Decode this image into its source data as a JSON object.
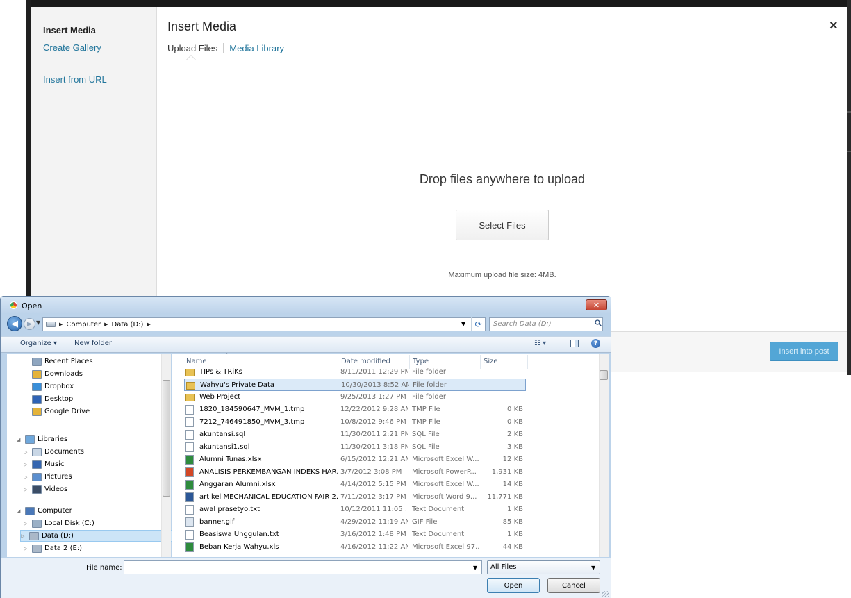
{
  "modal": {
    "sidebar_title": "Insert Media",
    "sidebar_links": [
      "Create Gallery",
      "Insert from URL"
    ],
    "title": "Insert Media",
    "close": "×",
    "tabs": [
      "Upload Files",
      "Media Library"
    ],
    "drop_text": "Drop files anywhere to upload",
    "select_button": "Select Files",
    "max_size": "Maximum upload file size: 4MB.",
    "insert_button": "Insert into post"
  },
  "dialog": {
    "title": "Open",
    "close": "✕",
    "breadcrumb": [
      "Computer",
      "Data (D:)"
    ],
    "search_placeholder": "Search Data (D:)",
    "organize": "Organize ▾",
    "new_folder": "New folder",
    "nav_items": [
      {
        "label": "Recent Places",
        "icon": "recent-places-icon",
        "color": "#8fa6c0"
      },
      {
        "label": "Downloads",
        "icon": "downloads-folder-icon",
        "color": "#e4b33a"
      },
      {
        "label": "Dropbox",
        "icon": "dropbox-icon",
        "color": "#3a8fd9"
      },
      {
        "label": "Desktop",
        "icon": "desktop-icon",
        "color": "#2f63b5"
      },
      {
        "label": "Google Drive",
        "icon": "google-drive-icon",
        "color": "#e4b33a"
      },
      {
        "label": "Libraries",
        "icon": "libraries-icon",
        "color": "#6fa8dc"
      },
      {
        "label": "Documents",
        "icon": "documents-icon",
        "color": "#c9d7e6"
      },
      {
        "label": "Music",
        "icon": "music-icon",
        "color": "#3566b0"
      },
      {
        "label": "Pictures",
        "icon": "pictures-icon",
        "color": "#5b8fcf"
      },
      {
        "label": "Videos",
        "icon": "videos-icon",
        "color": "#3b4d66"
      },
      {
        "label": "Computer",
        "icon": "computer-icon",
        "color": "#4a78b8"
      },
      {
        "label": "Local Disk (C:)",
        "icon": "local-disk-icon",
        "color": "#9bb0c6"
      },
      {
        "label": "Data (D:)",
        "icon": "drive-icon",
        "color": "#aab8c8"
      },
      {
        "label": "Data 2 (E:)",
        "icon": "drive-icon",
        "color": "#aab8c8"
      }
    ],
    "columns": [
      "Name",
      "Date modified",
      "Type",
      "Size"
    ],
    "files": [
      {
        "name": "TIPs & TRiKs",
        "date": "8/11/2011 12:29 PM",
        "type": "File folder",
        "size": "",
        "icon": "folder-icon",
        "color": "#e8c255"
      },
      {
        "name": "Wahyu's Private Data",
        "date": "10/30/2013 8:52 AM",
        "type": "File folder",
        "size": "",
        "icon": "folder-icon",
        "color": "#e8c255"
      },
      {
        "name": "Web Project",
        "date": "9/25/2013 1:27 PM",
        "type": "File folder",
        "size": "",
        "icon": "folder-icon",
        "color": "#e8c255"
      },
      {
        "name": "1820_184590647_MVM_1.tmp",
        "date": "12/22/2012 9:28 AM",
        "type": "TMP File",
        "size": "0 KB",
        "icon": "file-icon",
        "color": "#ffffff"
      },
      {
        "name": "7212_746491850_MVM_3.tmp",
        "date": "10/8/2012 9:46 PM",
        "type": "TMP File",
        "size": "0 KB",
        "icon": "file-icon",
        "color": "#ffffff"
      },
      {
        "name": "akuntansi.sql",
        "date": "11/30/2011 2:21 PM",
        "type": "SQL File",
        "size": "2 KB",
        "icon": "file-icon",
        "color": "#ffffff"
      },
      {
        "name": "akuntansi1.sql",
        "date": "11/30/2011 3:18 PM",
        "type": "SQL File",
        "size": "3 KB",
        "icon": "file-icon",
        "color": "#ffffff"
      },
      {
        "name": "Alumni Tunas.xlsx",
        "date": "6/15/2012 12:21 AM",
        "type": "Microsoft Excel W...",
        "size": "12 KB",
        "icon": "excel-icon",
        "color": "#2e8b3d"
      },
      {
        "name": "ANALISIS PERKEMBANGAN INDEKS HAR...",
        "date": "3/7/2012 3:08 PM",
        "type": "Microsoft PowerP...",
        "size": "1,931 KB",
        "icon": "powerpoint-icon",
        "color": "#d24726"
      },
      {
        "name": "Anggaran Alumni.xlsx",
        "date": "4/14/2012 5:15 PM",
        "type": "Microsoft Excel W...",
        "size": "14 KB",
        "icon": "excel-icon",
        "color": "#2e8b3d"
      },
      {
        "name": "artikel MECHANICAL EDUCATION FAIR 2...",
        "date": "7/11/2012 3:17 PM",
        "type": "Microsoft Word 9...",
        "size": "11,771 KB",
        "icon": "word-icon",
        "color": "#2b5797"
      },
      {
        "name": "awal prasetyo.txt",
        "date": "10/12/2011 11:05 ...",
        "type": "Text Document",
        "size": "1 KB",
        "icon": "text-file-icon",
        "color": "#ffffff"
      },
      {
        "name": "banner.gif",
        "date": "4/29/2012 11:19 AM",
        "type": "GIF File",
        "size": "85 KB",
        "icon": "image-file-icon",
        "color": "#dde6f0"
      },
      {
        "name": "Beasiswa Unggulan.txt",
        "date": "3/16/2012 1:48 PM",
        "type": "Text Document",
        "size": "1 KB",
        "icon": "text-file-icon",
        "color": "#ffffff"
      },
      {
        "name": "Beban Kerja Wahyu.xls",
        "date": "4/16/2012 11:22 AM",
        "type": "Microsoft Excel 97...",
        "size": "44 KB",
        "icon": "excel-icon",
        "color": "#2e8b3d"
      }
    ],
    "file_name_label": "File name:",
    "file_name_value": "",
    "file_type": "All Files",
    "open_button": "Open",
    "cancel_button": "Cancel"
  }
}
